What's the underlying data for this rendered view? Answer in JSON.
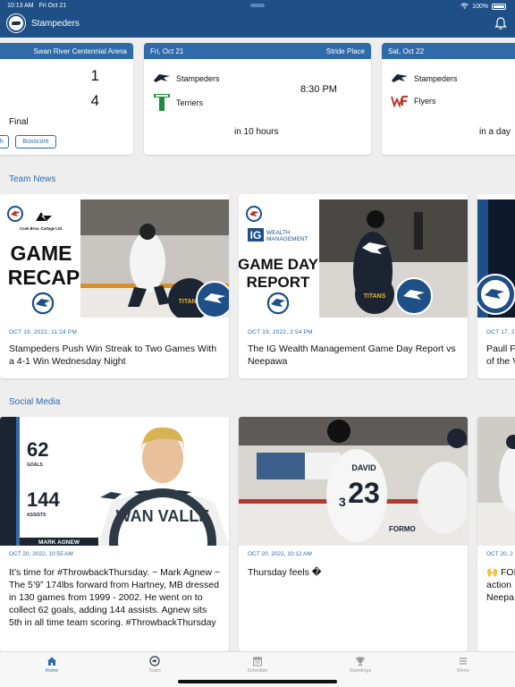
{
  "status_bar": {
    "time": "10:13 AM",
    "date": "Fri Oct 21",
    "battery": "100%"
  },
  "header": {
    "title": "Stampeders"
  },
  "games": [
    {
      "venue": "Swan River Centennial Arena",
      "home_score": "1",
      "away_score": "4",
      "status": "Final",
      "buttons": [
        "ch",
        "Boxscore"
      ]
    },
    {
      "date": "Fri, Oct 21",
      "venue": "Stride Place",
      "team1": "Stampeders",
      "team2": "Terriers",
      "time": "8:30 PM",
      "countdown": "in 10 hours"
    },
    {
      "date": "Sat, Oct 22",
      "team1": "Stampeders",
      "team2": "Flyers",
      "countdown": "in a day"
    }
  ],
  "sections": {
    "news": "Team News",
    "social": "Social Media"
  },
  "news": [
    {
      "date": "OCT 19, 2022, 11:24 PM",
      "title": "Stampeders Push Win Streak to Two Games With a 4-1 Win Wednesday Night",
      "graphic_line1": "GAME",
      "graphic_line2": "RECAP",
      "sponsor": "Cook Bros. Cartage Ltd.",
      "opponent_logo": "TITANS"
    },
    {
      "date": "OCT 19, 2022, 2:54 PM",
      "title": "The IG Wealth Management Game Day Report vs Neepawa",
      "graphic_line1": "GAME DAY",
      "graphic_line2": "REPORT",
      "sponsor_mark": "IG",
      "sponsor_line1": "WEALTH",
      "sponsor_line2": "MANAGEMENT",
      "opponent_logo": "TITANS"
    },
    {
      "date": "OCT 17, 2",
      "title": "Paull F\nof the V"
    }
  ],
  "social": [
    {
      "date": "OCT 20, 2022, 10:55 AM",
      "text": "It’s time for #ThrowbackThursday. ~ Mark Agnew ~ The 5’9” 174lbs forward from Hartney, MB dressed in 130 games from 1999 - 2002. He went on to collect 62 goals, adding 144 assists. Agnew sits 5th in all time team scoring. #ThrowbackThursday",
      "stat1_value": "62",
      "stat1_label": "GOALS",
      "stat2_value": "144",
      "stat2_label": "ASSISTS",
      "player_name": "MARK AGNEW",
      "logo_text": "WAN VALLE"
    },
    {
      "date": "OCT 20, 2022, 10:12 AM",
      "text": "Thursday feels �",
      "jersey_name": "DAVID",
      "jersey_number": "23",
      "jersey_number_2": "3",
      "jersey_text_2": "FORMO"
    },
    {
      "date": "OCT 20, 2",
      "text": "🙌 FOI\naction\nNeepa"
    }
  ],
  "tabs": [
    {
      "label": "Home",
      "icon": "home-icon",
      "active": true
    },
    {
      "label": "Team",
      "icon": "team-icon",
      "active": false
    },
    {
      "label": "Schedule",
      "icon": "calendar-icon",
      "active": false
    },
    {
      "label": "Standings",
      "icon": "trophy-icon",
      "active": false
    },
    {
      "label": "Menu",
      "icon": "menu-icon",
      "active": false
    }
  ],
  "colors": {
    "primary": "#1e4f86",
    "accent": "#2f6aa9",
    "background": "#eeeeee"
  }
}
